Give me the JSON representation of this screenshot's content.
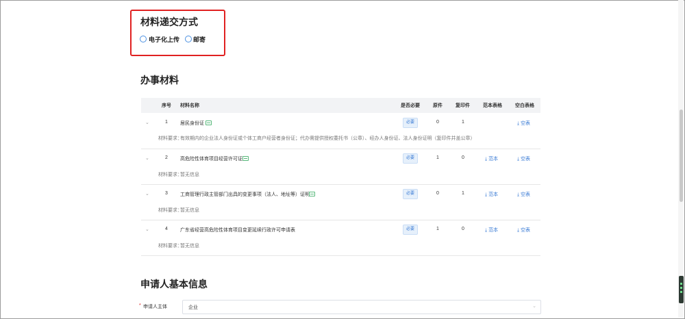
{
  "submit_method": {
    "title": "材料递交方式",
    "options": [
      {
        "label": "电子化上传",
        "selected": false
      },
      {
        "label": "邮寄",
        "selected": false
      }
    ]
  },
  "materials": {
    "title": "办事材料",
    "columns": [
      "序号",
      "材料名称",
      "是否必要",
      "原件",
      "复印件",
      "范本表格",
      "空白表格"
    ],
    "requirement_label": "材料要求：",
    "rows": [
      {
        "index": "1",
        "name": "居民身份证",
        "has_image_tag": true,
        "required": "必要",
        "original": "0",
        "copy": "1",
        "sample": "",
        "blank": "空表",
        "requirement": "有效期内的企业法人身份证或个体工商户经营者身份证；代办需提供授权委托书（公章）、经办人身份证、法人身份证明（复印件并盖公章）"
      },
      {
        "index": "2",
        "name": "高危险性体育项目经营许可证",
        "has_image_tag": true,
        "required": "必要",
        "original": "1",
        "copy": "0",
        "sample": "范本",
        "blank": "空表",
        "requirement": "暂无信息"
      },
      {
        "index": "3",
        "name": "工商管理行政主管部门出具的变更事项（法人、地址等）证明",
        "has_image_tag": true,
        "required": "必要",
        "original": "0",
        "copy": "1",
        "sample": "范本",
        "blank": "空表",
        "requirement": "暂无信息"
      },
      {
        "index": "4",
        "name": "广东省经营高危险性体育项目变更延续行政许可申请表",
        "has_image_tag": false,
        "required": "必要",
        "original": "1",
        "copy": "0",
        "sample": "范本",
        "blank": "空表",
        "requirement": "暂无信息"
      }
    ]
  },
  "applicant": {
    "title": "申请人基本信息",
    "subject_label": "申请人主体",
    "required_mark": "*",
    "subject_value": "企业"
  },
  "icons": {
    "download": "download-icon",
    "expand": "chevron-down-icon",
    "image_tag": "image-icon"
  }
}
